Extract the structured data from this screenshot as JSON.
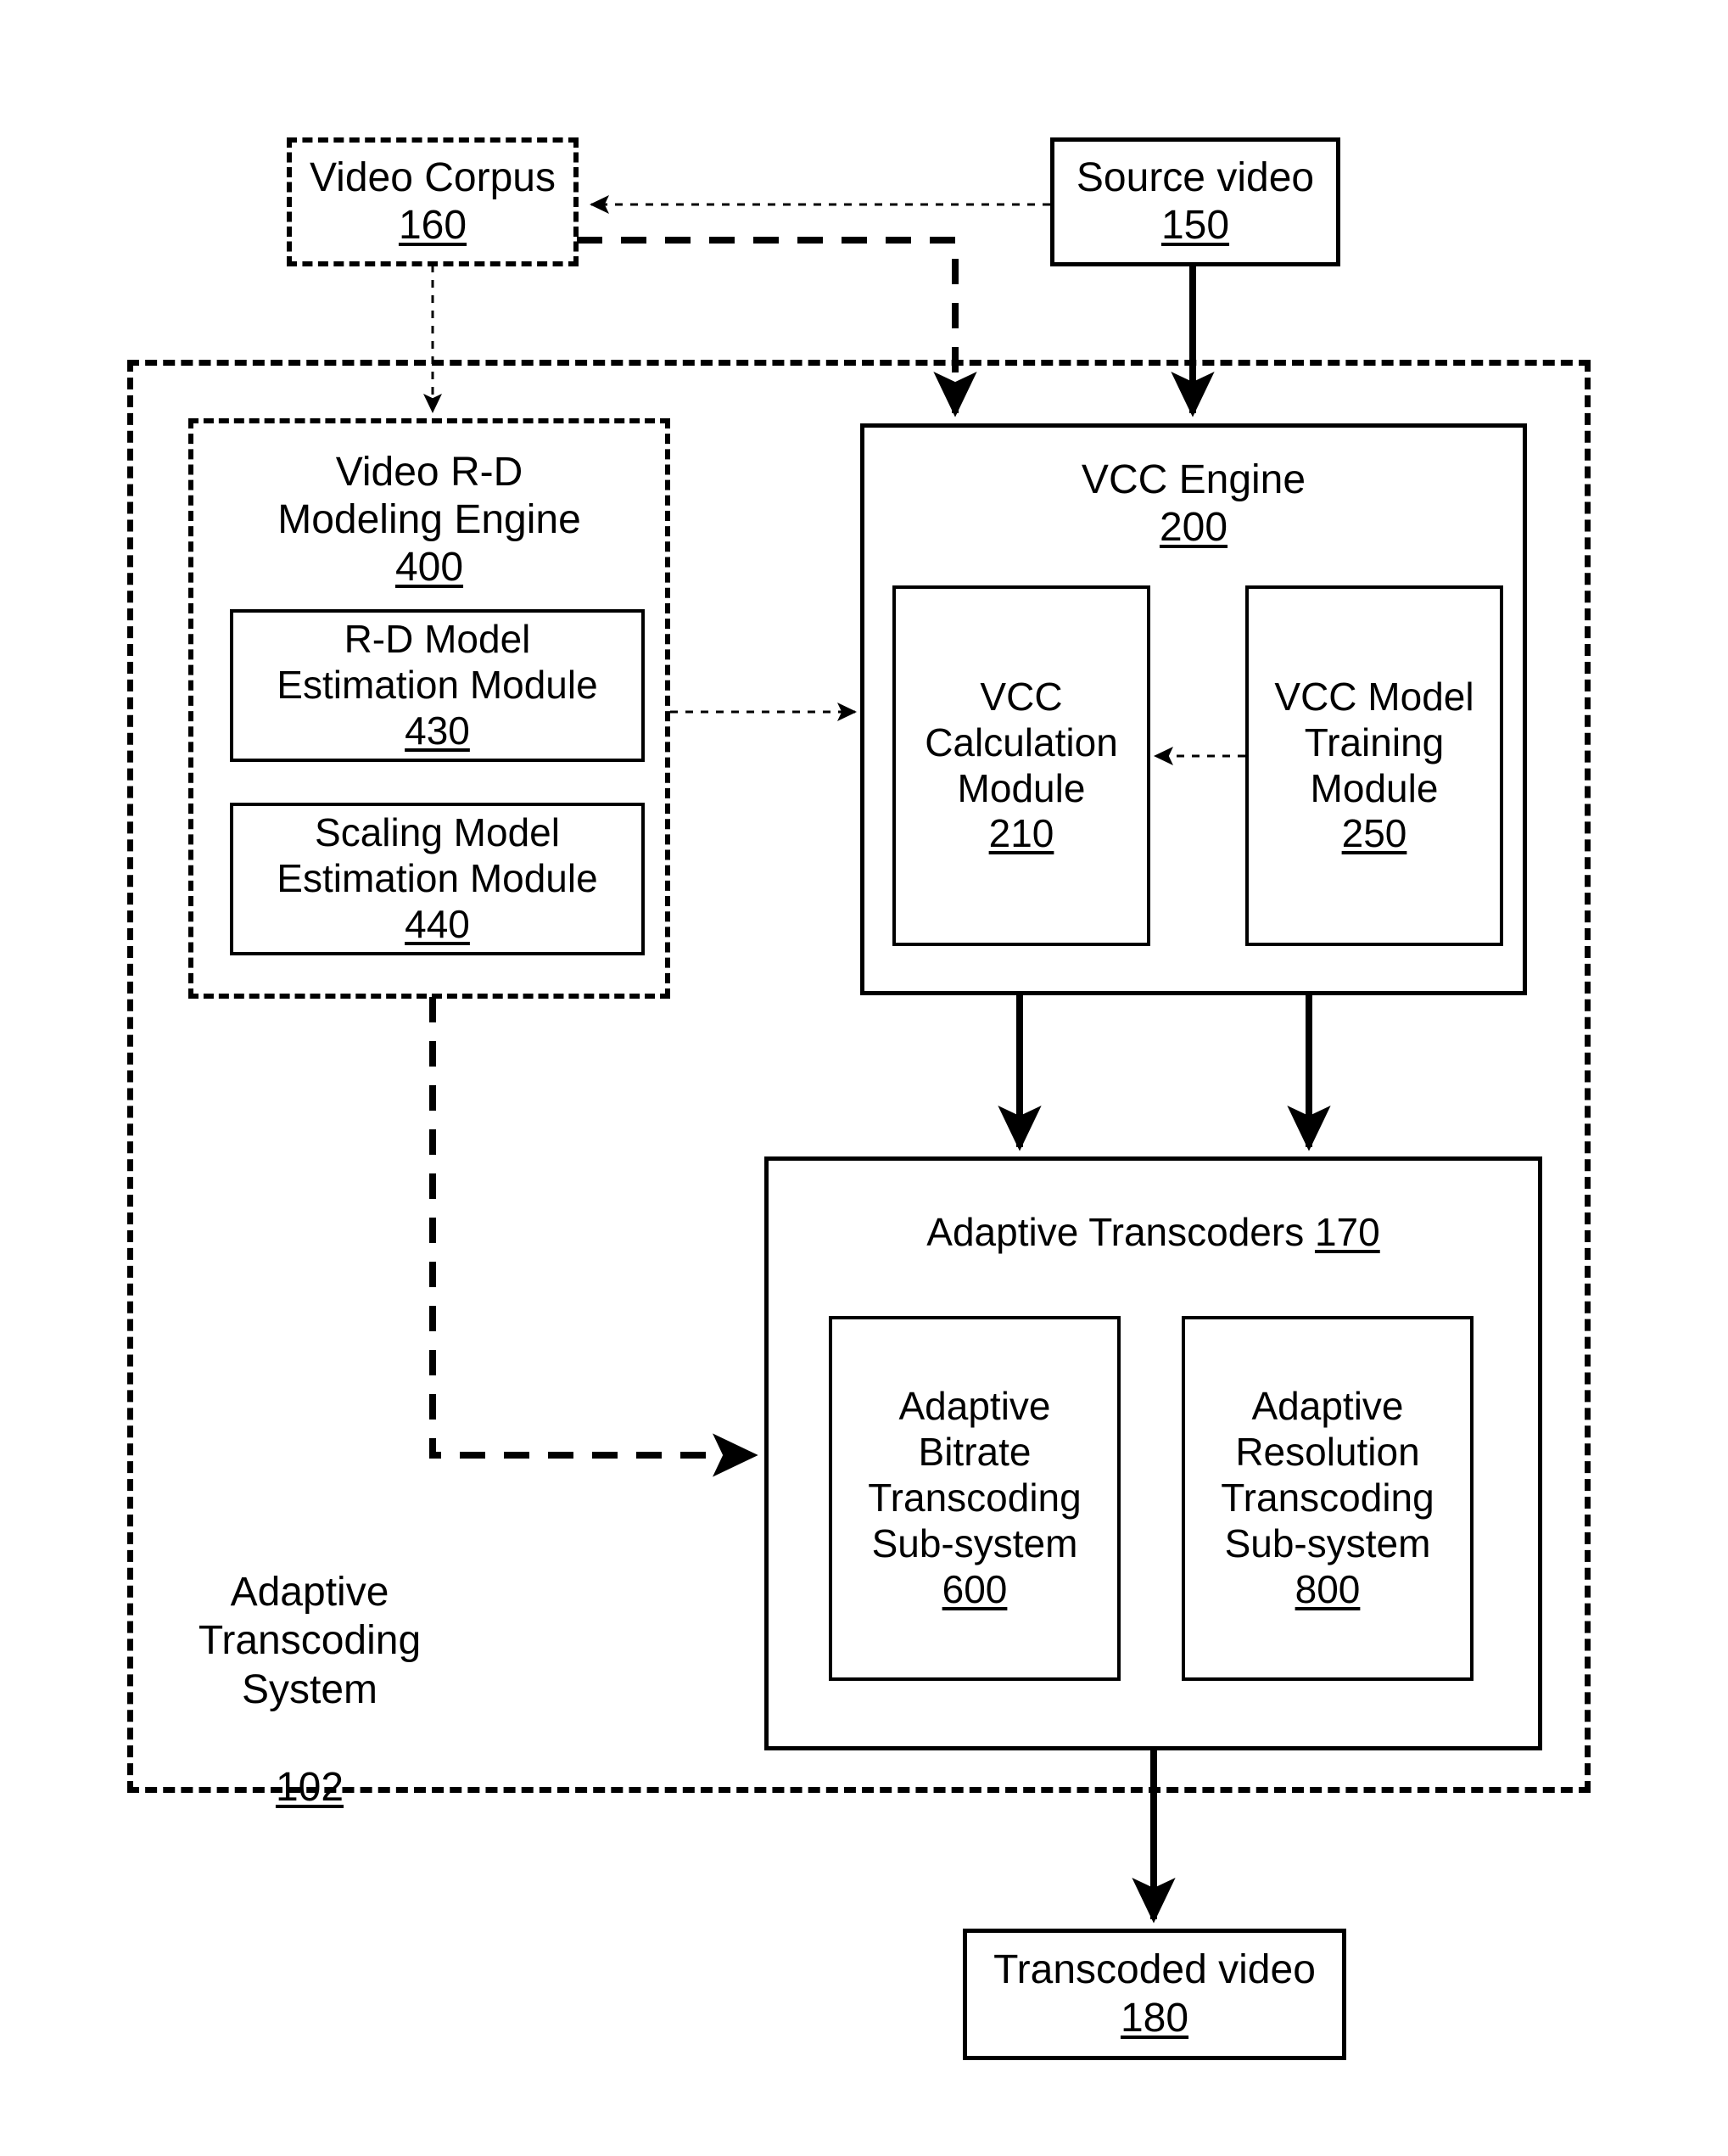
{
  "diagram": {
    "figure_type": "patent-block-diagram",
    "nodes": {
      "video_corpus": {
        "label": "Video Corpus",
        "ref": "160",
        "style": "dashed"
      },
      "source_video": {
        "label": "Source video",
        "ref": "150",
        "style": "solid"
      },
      "modeling_engine": {
        "label": "Video R-D\nModeling Engine",
        "ref": "400",
        "style": "dashed"
      },
      "rd_model_estimation": {
        "label": "R-D Model\nEstimation Module",
        "ref": "430",
        "style": "solid"
      },
      "scaling_model_estimation": {
        "label": "Scaling Model\nEstimation Module",
        "ref": "440",
        "style": "solid"
      },
      "vcc_engine": {
        "label": "VCC Engine",
        "ref": "200",
        "style": "solid"
      },
      "vcc_calculation": {
        "label": "VCC\nCalculation\nModule",
        "ref": "210",
        "style": "solid"
      },
      "vcc_model_training": {
        "label": "VCC Model\nTraining\nModule",
        "ref": "250",
        "style": "solid"
      },
      "adaptive_transcoders": {
        "label": "Adaptive Transcoders",
        "ref": "170",
        "style": "solid"
      },
      "adaptive_bitrate": {
        "label": "Adaptive\nBitrate\nTranscoding\nSub-system",
        "ref": "600",
        "style": "solid"
      },
      "adaptive_resolution": {
        "label": "Adaptive\nResolution\nTranscoding\nSub-system",
        "ref": "800",
        "style": "solid"
      },
      "transcoding_system": {
        "label": "Adaptive\nTranscoding\nSystem",
        "ref": "102",
        "style": "dashed-container"
      },
      "transcoded_video": {
        "label": "Transcoded video",
        "ref": "180",
        "style": "solid"
      }
    },
    "edges": [
      {
        "from": "source_video",
        "to": "video_corpus",
        "style": "dotted",
        "arrow": true
      },
      {
        "from": "video_corpus",
        "to": "modeling_engine",
        "style": "dotted",
        "arrow": true
      },
      {
        "from": "video_corpus",
        "to": "vcc_engine",
        "style": "dashed",
        "arrow": true
      },
      {
        "from": "source_video",
        "to": "vcc_engine",
        "style": "solid",
        "arrow": true
      },
      {
        "from": "rd_model_estimation",
        "to": "vcc_calculation",
        "style": "dotted",
        "arrow": true
      },
      {
        "from": "vcc_model_training",
        "to": "vcc_calculation",
        "style": "dotted",
        "arrow": true
      },
      {
        "from": "vcc_engine",
        "to": "adaptive_bitrate",
        "style": "solid",
        "arrow": true
      },
      {
        "from": "vcc_engine",
        "to": "adaptive_resolution",
        "style": "solid",
        "arrow": true
      },
      {
        "from": "scaling_model_estimation",
        "to": "adaptive_transcoders",
        "style": "dashed",
        "arrow": true
      },
      {
        "from": "adaptive_transcoders",
        "to": "transcoded_video",
        "style": "solid",
        "arrow": true
      }
    ],
    "colors": {
      "line": "#000000",
      "background": "#ffffff",
      "text": "#000000"
    }
  }
}
